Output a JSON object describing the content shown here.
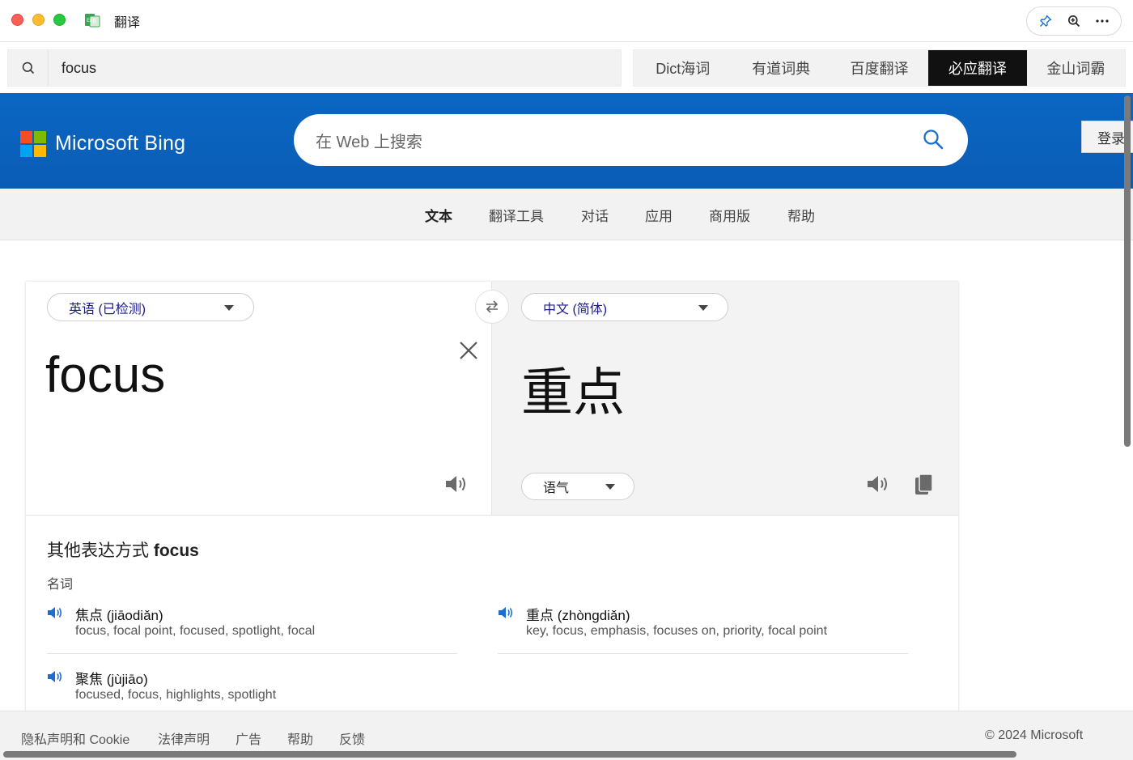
{
  "window": {
    "title": "翻译",
    "icons": [
      "pin-icon",
      "zoom-in-icon",
      "more-icon"
    ]
  },
  "search": {
    "query": "focus"
  },
  "source_tabs": [
    {
      "label": "Dict海词",
      "active": false
    },
    {
      "label": "有道词典",
      "active": false
    },
    {
      "label": "百度翻译",
      "active": false
    },
    {
      "label": "必应翻译",
      "active": true
    },
    {
      "label": "金山词霸",
      "active": false
    }
  ],
  "bing": {
    "brand": "Microsoft Bing",
    "search_placeholder": "在 Web 上搜索",
    "login_label": "登录",
    "logo_colors": [
      "#f25022",
      "#7fba00",
      "#00a4ef",
      "#ffb900"
    ]
  },
  "nav": {
    "items": [
      "文本",
      "翻译工具",
      "对话",
      "应用",
      "商用版",
      "帮助"
    ],
    "active": "文本"
  },
  "translator": {
    "source_lang": "英语 (已检测)",
    "target_lang": "中文 (简体)",
    "source_text": "focus",
    "target_text": "重点",
    "tone_label": "语气"
  },
  "alternatives": {
    "title_prefix": "其他表达方式",
    "title_word": "focus",
    "pos": "名词",
    "entries": [
      {
        "head": "焦点 (jiāodiǎn)",
        "back": "focus, focal point, focused, spotlight, focal"
      },
      {
        "head": "重点 (zhòngdiǎn)",
        "back": "key, focus, emphasis, focuses on, priority, focal point"
      },
      {
        "head": "聚焦 (jùjiāo)",
        "back": "focused, focus, highlights, spotlight"
      }
    ]
  },
  "footer": {
    "links": [
      "隐私声明和 Cookie",
      "法律声明",
      "广告",
      "帮助",
      "反馈"
    ],
    "copyright": "© 2024 Microsoft"
  },
  "colors": {
    "bing_blue": "#0a67c3",
    "active_tab": "#111111",
    "speaker_blue": "#1a6fd0"
  }
}
